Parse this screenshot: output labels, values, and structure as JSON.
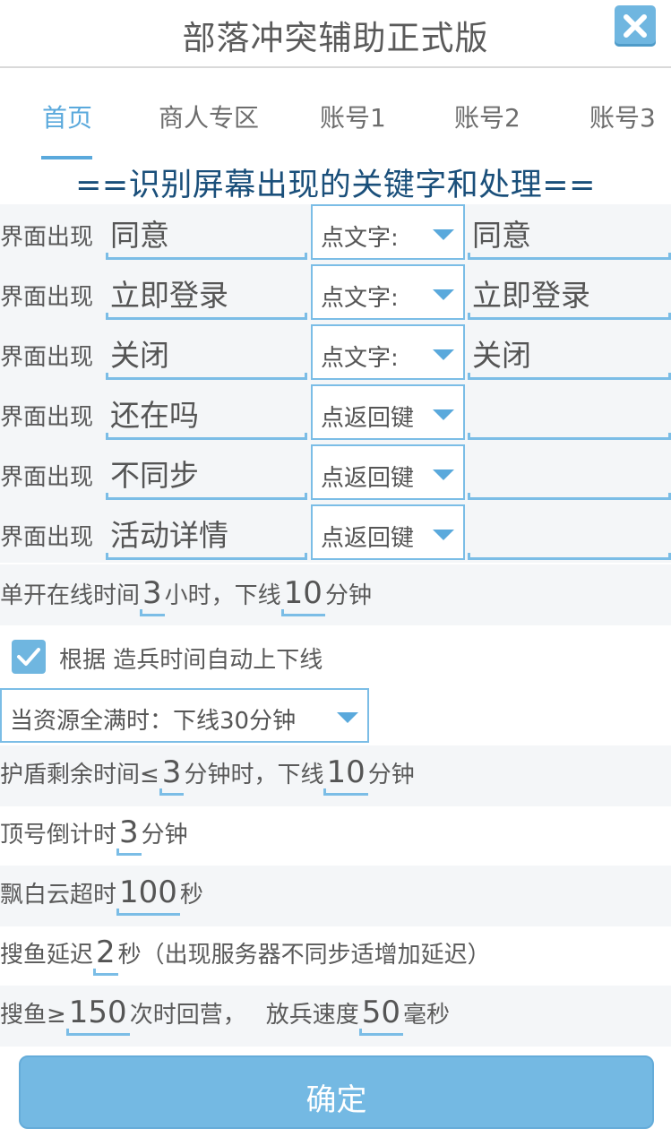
{
  "titlebar": {
    "title": "部落冲突辅助正式版"
  },
  "tabs": [
    {
      "label": "首页"
    },
    {
      "label": "商人专区"
    },
    {
      "label": "账号1"
    },
    {
      "label": "账号2"
    },
    {
      "label": "账号3"
    }
  ],
  "heading": "==识别屏幕出现的关键字和处理==",
  "rules": [
    {
      "prefix": "界面出现",
      "keyword": "同意",
      "action": "点文字:",
      "target": "同意"
    },
    {
      "prefix": "界面出现",
      "keyword": "立即登录",
      "action": "点文字:",
      "target": "立即登录"
    },
    {
      "prefix": "界面出现",
      "keyword": "关闭",
      "action": "点文字:",
      "target": "关闭"
    },
    {
      "prefix": "界面出现",
      "keyword": "还在吗",
      "action": "点返回键",
      "target": ""
    },
    {
      "prefix": "界面出现",
      "keyword": "不同步",
      "action": "点返回键",
      "target": ""
    },
    {
      "prefix": "界面出现",
      "keyword": "活动详情",
      "action": "点返回键",
      "target": ""
    }
  ],
  "online": {
    "pre": "单开在线时间",
    "hours": "3",
    "mid": "小时，下线",
    "minutes": "10",
    "post": "分钟"
  },
  "auto_online": {
    "checked": true,
    "label": "根据 造兵时间自动上下线"
  },
  "resource_full": {
    "value": "当资源全满时：下线30分钟"
  },
  "shield": {
    "pre": "护盾剩余时间≤",
    "minutes": "3",
    "mid": "分钟时，下线",
    "off_minutes": "10",
    "post": "分钟"
  },
  "top_countdown": {
    "pre": "顶号倒计时",
    "minutes": "3",
    "post": "分钟"
  },
  "cloud_timeout": {
    "pre": "飘白云超时",
    "seconds": "100",
    "post": "秒"
  },
  "search_delay": {
    "pre": "搜鱼延迟",
    "seconds": "2",
    "post": "秒（出现服务器不同步适增加延迟）"
  },
  "search_limit": {
    "pre": "搜鱼≥",
    "count": "150",
    "mid": "次时回营，",
    "mid2": "放兵速度",
    "speed": "50",
    "post": "毫秒"
  },
  "confirm": {
    "label": "确定"
  },
  "colors": {
    "accent": "#6fb6e0",
    "heading": "#1a4f7a",
    "button": "#74b9e3"
  }
}
